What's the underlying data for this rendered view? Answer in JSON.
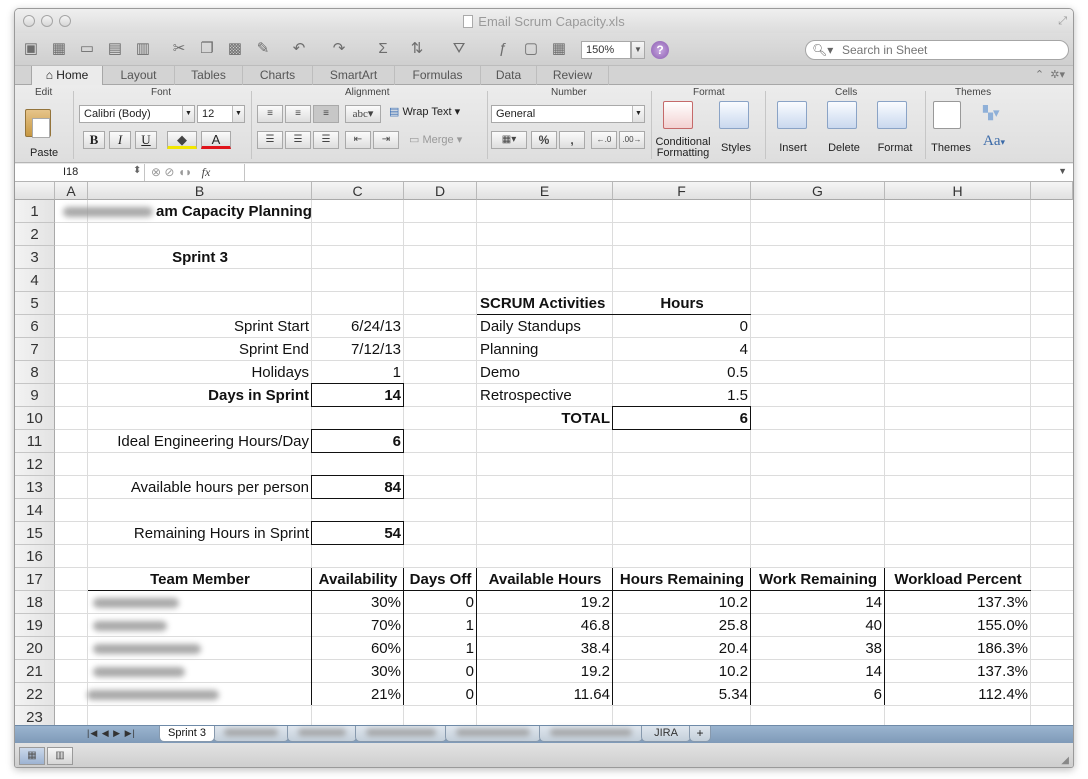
{
  "window": {
    "title": "Email Scrum Capacity.xls"
  },
  "toolbar": {
    "zoom": "150%",
    "search_placeholder": "Search in Sheet"
  },
  "ribbon_tabs": [
    "Home",
    "Layout",
    "Tables",
    "Charts",
    "SmartArt",
    "Formulas",
    "Data",
    "Review"
  ],
  "ribbon": {
    "groups": {
      "edit": "Edit",
      "font": "Font",
      "alignment": "Alignment",
      "number": "Number",
      "format": "Format",
      "cells": "Cells",
      "themes": "Themes"
    },
    "paste_label": "Paste",
    "font_name": "Calibri (Body)",
    "font_size": "12",
    "bold": "B",
    "italic": "I",
    "underline": "U",
    "wrap_text": "Wrap Text",
    "merge": "Merge",
    "abc": "abc",
    "number_format": "General",
    "percent": "%",
    "comma": ",",
    "conditional_formatting_line1": "Conditional",
    "conditional_formatting_line2": "Formatting",
    "styles": "Styles",
    "insert": "Insert",
    "delete": "Delete",
    "format_btn": "Format",
    "themes_btn": "Themes",
    "aa": "Aa"
  },
  "formula_bar": {
    "cell_ref": "I18",
    "fx": "fx"
  },
  "columns": [
    "A",
    "B",
    "C",
    "D",
    "E",
    "F",
    "G",
    "H"
  ],
  "rows": [
    "1",
    "2",
    "3",
    "4",
    "5",
    "6",
    "7",
    "8",
    "9",
    "10",
    "11",
    "12",
    "13",
    "14",
    "15",
    "16",
    "17",
    "18",
    "19",
    "20",
    "21",
    "22",
    "23"
  ],
  "sheet": {
    "title_suffix": "am Capacity Planning",
    "sprint_name": "Sprint 3",
    "sprint_start_label": "Sprint Start",
    "sprint_start": "6/24/13",
    "sprint_end_label": "Sprint End",
    "sprint_end": "7/12/13",
    "holidays_label": "Holidays",
    "holidays": "1",
    "days_label": "Days in Sprint",
    "days": "14",
    "ideal_label": "Ideal Engineering Hours/Day",
    "ideal": "6",
    "available_label": "Available hours per person",
    "available": "84",
    "remaining_label": "Remaining Hours in Sprint",
    "remaining": "54",
    "scrum_header": "SCRUM Activities",
    "hours_header": "Hours",
    "activities": [
      {
        "name": "Daily Standups",
        "hours": "0"
      },
      {
        "name": "Planning",
        "hours": "4"
      },
      {
        "name": "Demo",
        "hours": "0.5"
      },
      {
        "name": "Retrospective",
        "hours": "1.5"
      }
    ],
    "total_label": "TOTAL",
    "total": "6",
    "team_headers": [
      "Team Member",
      "Availability",
      "Days Off",
      "Available Hours",
      "Hours Remaining",
      "Work Remaining",
      "Workload Percent"
    ],
    "team": [
      {
        "availability": "30%",
        "days_off": "0",
        "available_hours": "19.2",
        "hours_remaining": "10.2",
        "work_remaining": "14",
        "workload": "137.3%"
      },
      {
        "availability": "70%",
        "days_off": "1",
        "available_hours": "46.8",
        "hours_remaining": "25.8",
        "work_remaining": "40",
        "workload": "155.0%"
      },
      {
        "availability": "60%",
        "days_off": "1",
        "available_hours": "38.4",
        "hours_remaining": "20.4",
        "work_remaining": "38",
        "workload": "186.3%"
      },
      {
        "availability": "30%",
        "days_off": "0",
        "available_hours": "19.2",
        "hours_remaining": "10.2",
        "work_remaining": "14",
        "workload": "137.3%"
      },
      {
        "availability": "21%",
        "days_off": "0",
        "available_hours": "11.64",
        "hours_remaining": "5.34",
        "work_remaining": "6",
        "workload": "112.4%"
      }
    ]
  },
  "sheet_tabs": {
    "active": "Sprint 3",
    "last": "JIRA",
    "add": "+"
  },
  "colors": {
    "sheet_tab_bar": "#8ea8c4",
    "help_icon": "#8b5cb0"
  }
}
